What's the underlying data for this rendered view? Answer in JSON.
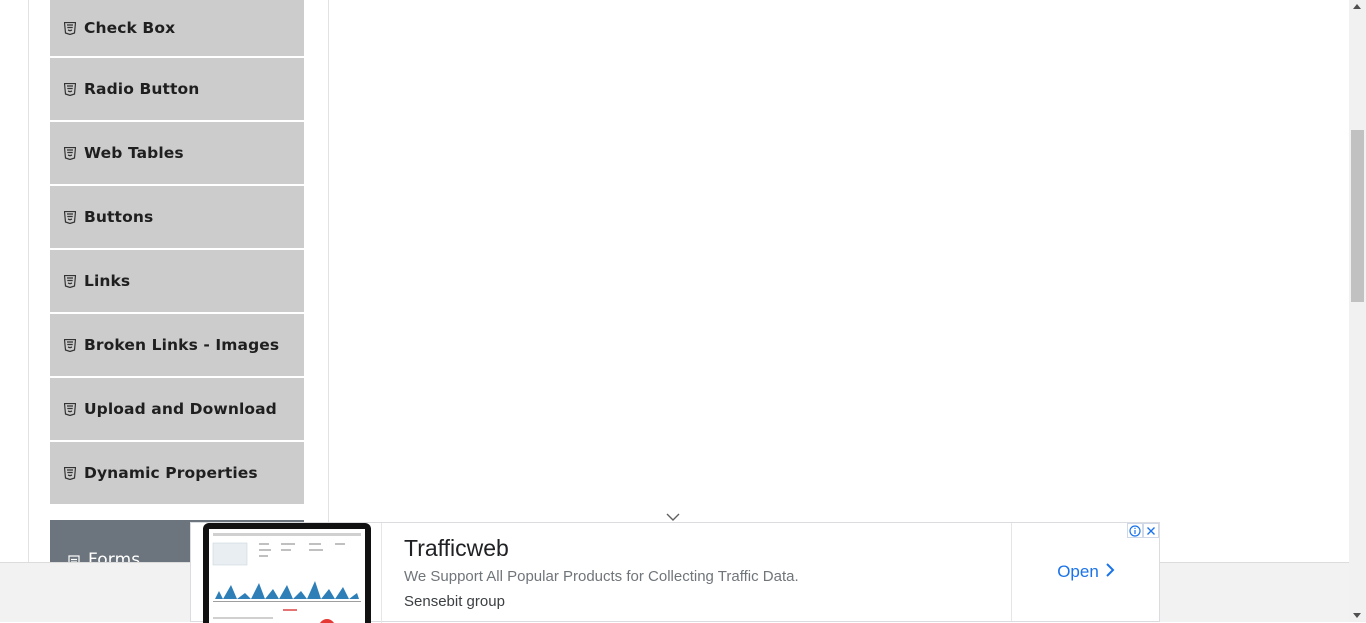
{
  "sidebar": {
    "items": [
      {
        "label": "Check Box",
        "icon": "html5-icon"
      },
      {
        "label": "Radio Button",
        "icon": "html5-icon"
      },
      {
        "label": "Web Tables",
        "icon": "html5-icon"
      },
      {
        "label": "Buttons",
        "icon": "html5-icon"
      },
      {
        "label": "Links",
        "icon": "html5-icon"
      },
      {
        "label": "Broken Links - Images",
        "icon": "html5-icon"
      },
      {
        "label": "Upload and Download",
        "icon": "html5-icon"
      },
      {
        "label": "Dynamic Properties",
        "icon": "html5-icon"
      }
    ],
    "next_group": {
      "label": "Forms",
      "icon": "document-icon"
    }
  },
  "ad": {
    "title": "Trafficweb",
    "description": "We Support All Popular Products for Collecting Traffic Data.",
    "advertiser": "Sensebit group",
    "cta_label": "Open",
    "accent_color": "#1a73e8"
  },
  "colors": {
    "menu_item_bg": "#cccccc",
    "group_header_bg": "#6c757d"
  }
}
